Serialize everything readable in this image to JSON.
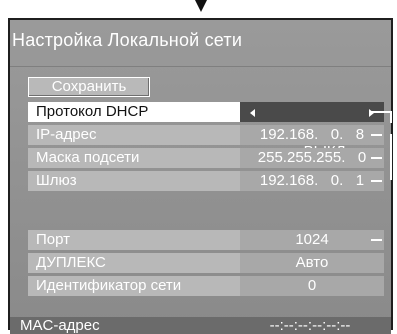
{
  "title": "Настройка Локальной сети",
  "save_button": "Сохранить",
  "rows": [
    {
      "label": "Протокол DHCP",
      "value": "ВЫКЛ"
    },
    {
      "label": "IP-адрес",
      "value": "192.168.   0.   8"
    },
    {
      "label": "Маска подсети",
      "value": "255.255.255.   0"
    },
    {
      "label": "Шлюз",
      "value": "192.168.   0.   1"
    },
    {
      "label": "Порт",
      "value": "1024"
    },
    {
      "label": "ДУПЛЕКС",
      "value": "Авто"
    },
    {
      "label": "Идентификатор сети",
      "value": "0"
    }
  ],
  "mac": {
    "label": "MAC-адрес",
    "value": "--:--:--:--:--:--"
  }
}
